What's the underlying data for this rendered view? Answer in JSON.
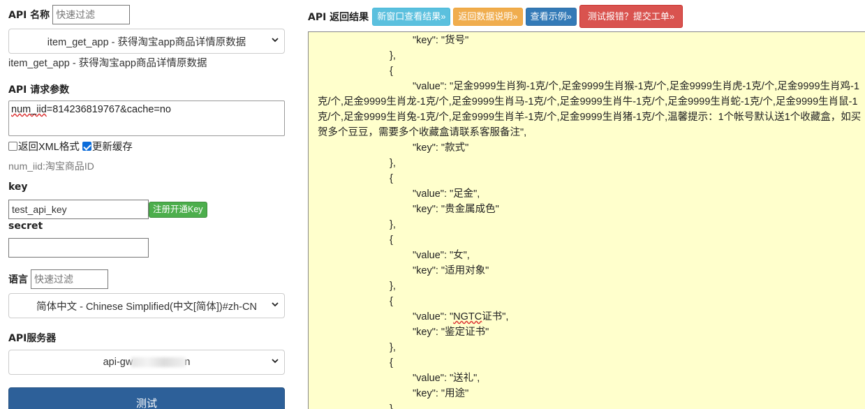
{
  "api_name": {
    "label": "API 名称",
    "filter_placeholder": "快速过滤",
    "selected": "item_get_app - 获得淘宝app商品详情原数据",
    "description": "item_get_app - 获得淘宝app商品详情原数据"
  },
  "params": {
    "label": "API 请求参数",
    "value_underlined": "num_iid",
    "value_rest": "=814236819767&cache=no",
    "xml_label": "返回XML格式",
    "xml_checked": false,
    "cache_label": "更新缓存",
    "cache_checked": true,
    "hint": "num_iid:淘宝商品ID"
  },
  "key": {
    "label": "key",
    "value": "test_api_key",
    "register_button": "注册开通Key"
  },
  "secret": {
    "label": "secret",
    "value": ""
  },
  "language": {
    "label": "语言",
    "filter_placeholder": "快速过滤",
    "selected": "简体中文 - Chinese Simplified(中文[简体])#zh-CN"
  },
  "server": {
    "label": "API服务器",
    "selected_prefix": "api-gw",
    "selected_suffix": "n"
  },
  "test_button": "测试",
  "result": {
    "label": "API 返回结果",
    "buttons": {
      "new_window": "新窗口查看结果»",
      "data_desc": "返回数据说明»",
      "example": "查看示例»",
      "report": "测试报错？提交工单»"
    },
    "lines": [
      "\t\t\"key\": \"货号\"",
      "\t},",
      "\t{",
      "\t\t\"value\": \"足金9999生肖狗-1克/个,足金9999生肖猴-1克/个,足金9999生肖虎-1克/个,足金9999生肖鸡-1克/个,足金9999生肖龙-1克/个,足金9999生肖马-1克/个,足金9999生肖牛-1克/个,足金9999生肖蛇-1克/个,足金9999生肖鼠-1克/个,足金9999生肖兔-1克/个,足金9999生肖羊-1克/个,足金9999生肖猪-1克/个,温馨提示：1个帐号默认送1个收藏盒，如买 贺多个豆豆，需要多个收藏盒请联系客服备注\",",
      "\t\t\"key\": \"款式\"",
      "\t},",
      "\t{",
      "\t\t\"value\": \"足金\",",
      "\t\t\"key\": \"贵金属成色\"",
      "\t},",
      "\t{",
      "\t\t\"value\": \"女\",",
      "\t\t\"key\": \"适用对象\"",
      "\t},",
      "\t{",
      "\t\t\"value\": \"NGTC证书\",",
      "\t\t\"key\": \"鉴定证书\"",
      "\t},",
      "\t{",
      "\t\t\"value\": \"送礼\",",
      "\t\t\"key\": \"用途\"",
      "\t},"
    ]
  }
}
